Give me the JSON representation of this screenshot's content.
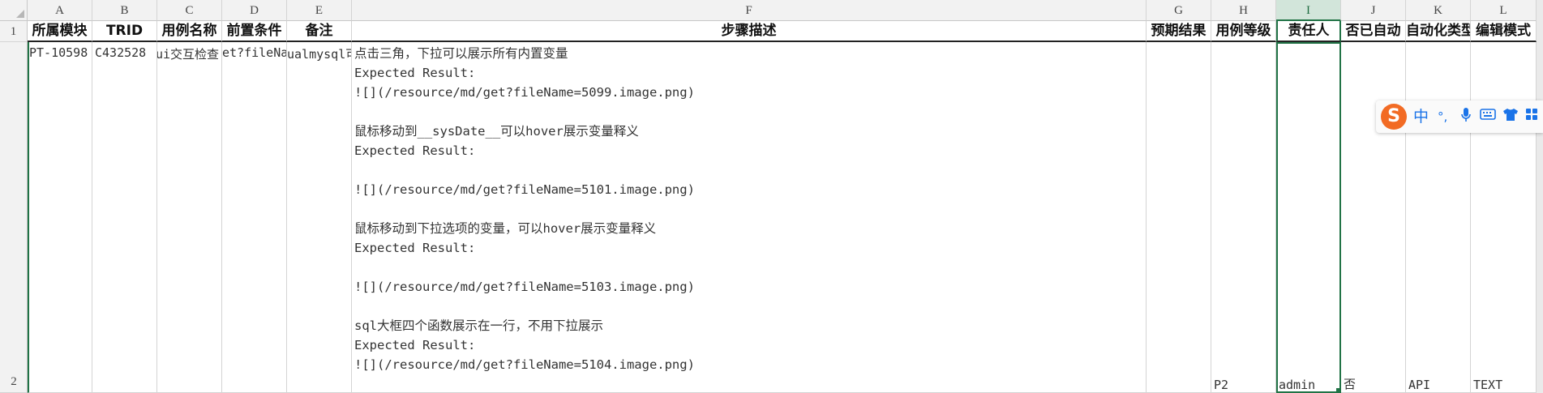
{
  "columns": [
    "A",
    "B",
    "C",
    "D",
    "E",
    "F",
    "G",
    "H",
    "I",
    "J",
    "K",
    "L"
  ],
  "row_numbers": [
    "1",
    "2"
  ],
  "headers": [
    "所属模块",
    "TRID",
    "用例名称",
    "前置条件",
    "备注",
    "步骤描述",
    "预期结果",
    "用例等级",
    "责任人",
    "否已自动",
    "自动化类型",
    "编辑模式"
  ],
  "row2": {
    "a": "PT-10598",
    "b": "C432528",
    "c": "ui交互检查",
    "d": "et?fileNa",
    "e": "ualmysql可",
    "g": "",
    "h": "P2",
    "i": "admin",
    "j": "否",
    "k": "API",
    "l": "TEXT"
  },
  "steps": [
    "点击三角，下拉可以展示所有内置变量",
    "Expected Result:",
    "![](/resource/md/get?fileName=5099.image.png)",
    "",
    "鼠标移动到__sysDate__可以hover展示变量释义",
    "Expected Result:",
    "",
    "![](/resource/md/get?fileName=5101.image.png)",
    "",
    "鼠标移动到下拉选项的变量，可以hover展示变量释义",
    "Expected Result:",
    "",
    "![](/resource/md/get?fileName=5103.image.png)",
    "",
    "sql大框四个函数展示在一行，不用下拉展示",
    "Expected Result:",
    "![](/resource/md/get?fileName=5104.image.png)"
  ],
  "ime": {
    "logo": "S",
    "mode_label": "中",
    "punct_label": "°,",
    "icons": [
      "mic-icon",
      "keyboard-icon",
      "skin-icon",
      "grid-icon"
    ]
  }
}
